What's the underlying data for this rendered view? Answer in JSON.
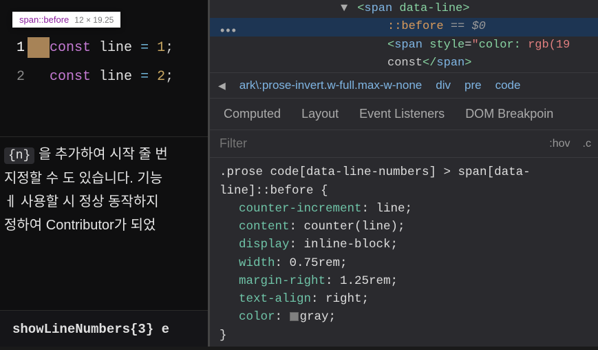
{
  "tooltip": {
    "selector": "span::before",
    "dimensions": "12 × 19.25"
  },
  "code": {
    "lines": [
      {
        "n": "1",
        "kw": "const",
        "var": "line",
        "op": "=",
        "val": "1",
        "p": ";"
      },
      {
        "n": "2",
        "kw": "const",
        "var": "line",
        "op": "=",
        "val": "2",
        "p": ";"
      }
    ]
  },
  "prose": {
    "tag": "{n}",
    "t1": " 을 추가하여 시작 줄 번",
    "t2": "지정할 수 도 있습니다. 기능",
    "t3": "ㅔ 사용할 시 정상 동작하지",
    "t4": "정하여 Contributor가 되었"
  },
  "bottom_code": "showLineNumbers{3} e",
  "elements": {
    "dots": "•••",
    "line_span": {
      "open": "<",
      "tag": "span",
      "attr": "data-line",
      "close": ">"
    },
    "before": {
      "pseudo": "::before",
      "eq": " == ",
      "dollar": "$0"
    },
    "inner": {
      "open": "<",
      "tag": "span",
      "attr": "style",
      "eq": "=",
      "val": "\"",
      "prop": "color: ",
      "rgb": "rgb(19",
      "end": ""
    },
    "text": "const",
    "close": {
      "open": "</",
      "tag": "span",
      "close": ">"
    }
  },
  "breadcrumb": {
    "arrow": "◀",
    "c1": "ark\\:prose-invert.w-full.max-w-none",
    "c2": "div",
    "c3": "pre",
    "c4": "code"
  },
  "tabs": {
    "computed": "Computed",
    "layout": "Layout",
    "listeners": "Event Listeners",
    "dom": "DOM Breakpoin"
  },
  "filter": {
    "placeholder": "Filter",
    "hov": ":hov",
    "cls": ".c"
  },
  "css": {
    "selector": ".prose code[data-line-numbers] > span[data-line]::before {",
    "props": [
      {
        "k": "counter-increment",
        "v": "line;"
      },
      {
        "k": "content",
        "v": "counter(line);"
      },
      {
        "k": "display",
        "v": "inline-block;"
      },
      {
        "k": "width",
        "v": "0.75rem;"
      },
      {
        "k": "margin-right",
        "v": "1.25rem;"
      },
      {
        "k": "text-align",
        "v": "right;"
      },
      {
        "k": "color",
        "v": "gray;",
        "swatch": true
      }
    ],
    "close": "}"
  }
}
